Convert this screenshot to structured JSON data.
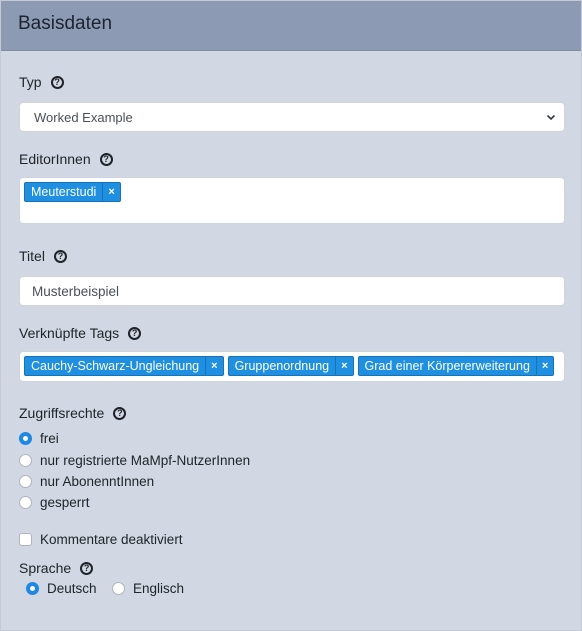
{
  "header": {
    "title": "Basisdaten"
  },
  "typ": {
    "label": "Typ",
    "help_icon": "question-circle-icon",
    "selected": "Worked Example"
  },
  "editors": {
    "label": "EditorInnen",
    "tags": [
      {
        "label": "Meuterstudi",
        "remove": "×"
      }
    ]
  },
  "title_field": {
    "label": "Titel",
    "value": "Musterbeispiel"
  },
  "linked_tags": {
    "label": "Verknüpfte Tags",
    "tags": [
      {
        "label": "Cauchy-Schwarz-Ungleichung",
        "remove": "×"
      },
      {
        "label": "Gruppenordnung",
        "remove": "×"
      },
      {
        "label": "Grad einer Körpererweiterung",
        "remove": "×"
      }
    ]
  },
  "access": {
    "label": "Zugriffsrechte",
    "options": [
      {
        "label": "frei",
        "selected": true
      },
      {
        "label": "nur registrierte MaMpf-NutzerInnen",
        "selected": false
      },
      {
        "label": "nur AbonenntInnen",
        "selected": false
      },
      {
        "label": "gesperrt",
        "selected": false
      }
    ]
  },
  "comments": {
    "label": "Kommentare deaktiviert",
    "checked": false
  },
  "language": {
    "label": "Sprache",
    "options": [
      {
        "label": "Deutsch",
        "selected": true
      },
      {
        "label": "Englisch",
        "selected": false
      }
    ]
  },
  "colors": {
    "header_bg": "#8c9ab3",
    "card_bg": "#d1d8e3",
    "tag_bg": "#1e8fe1",
    "radio_active": "#1e88e5"
  }
}
